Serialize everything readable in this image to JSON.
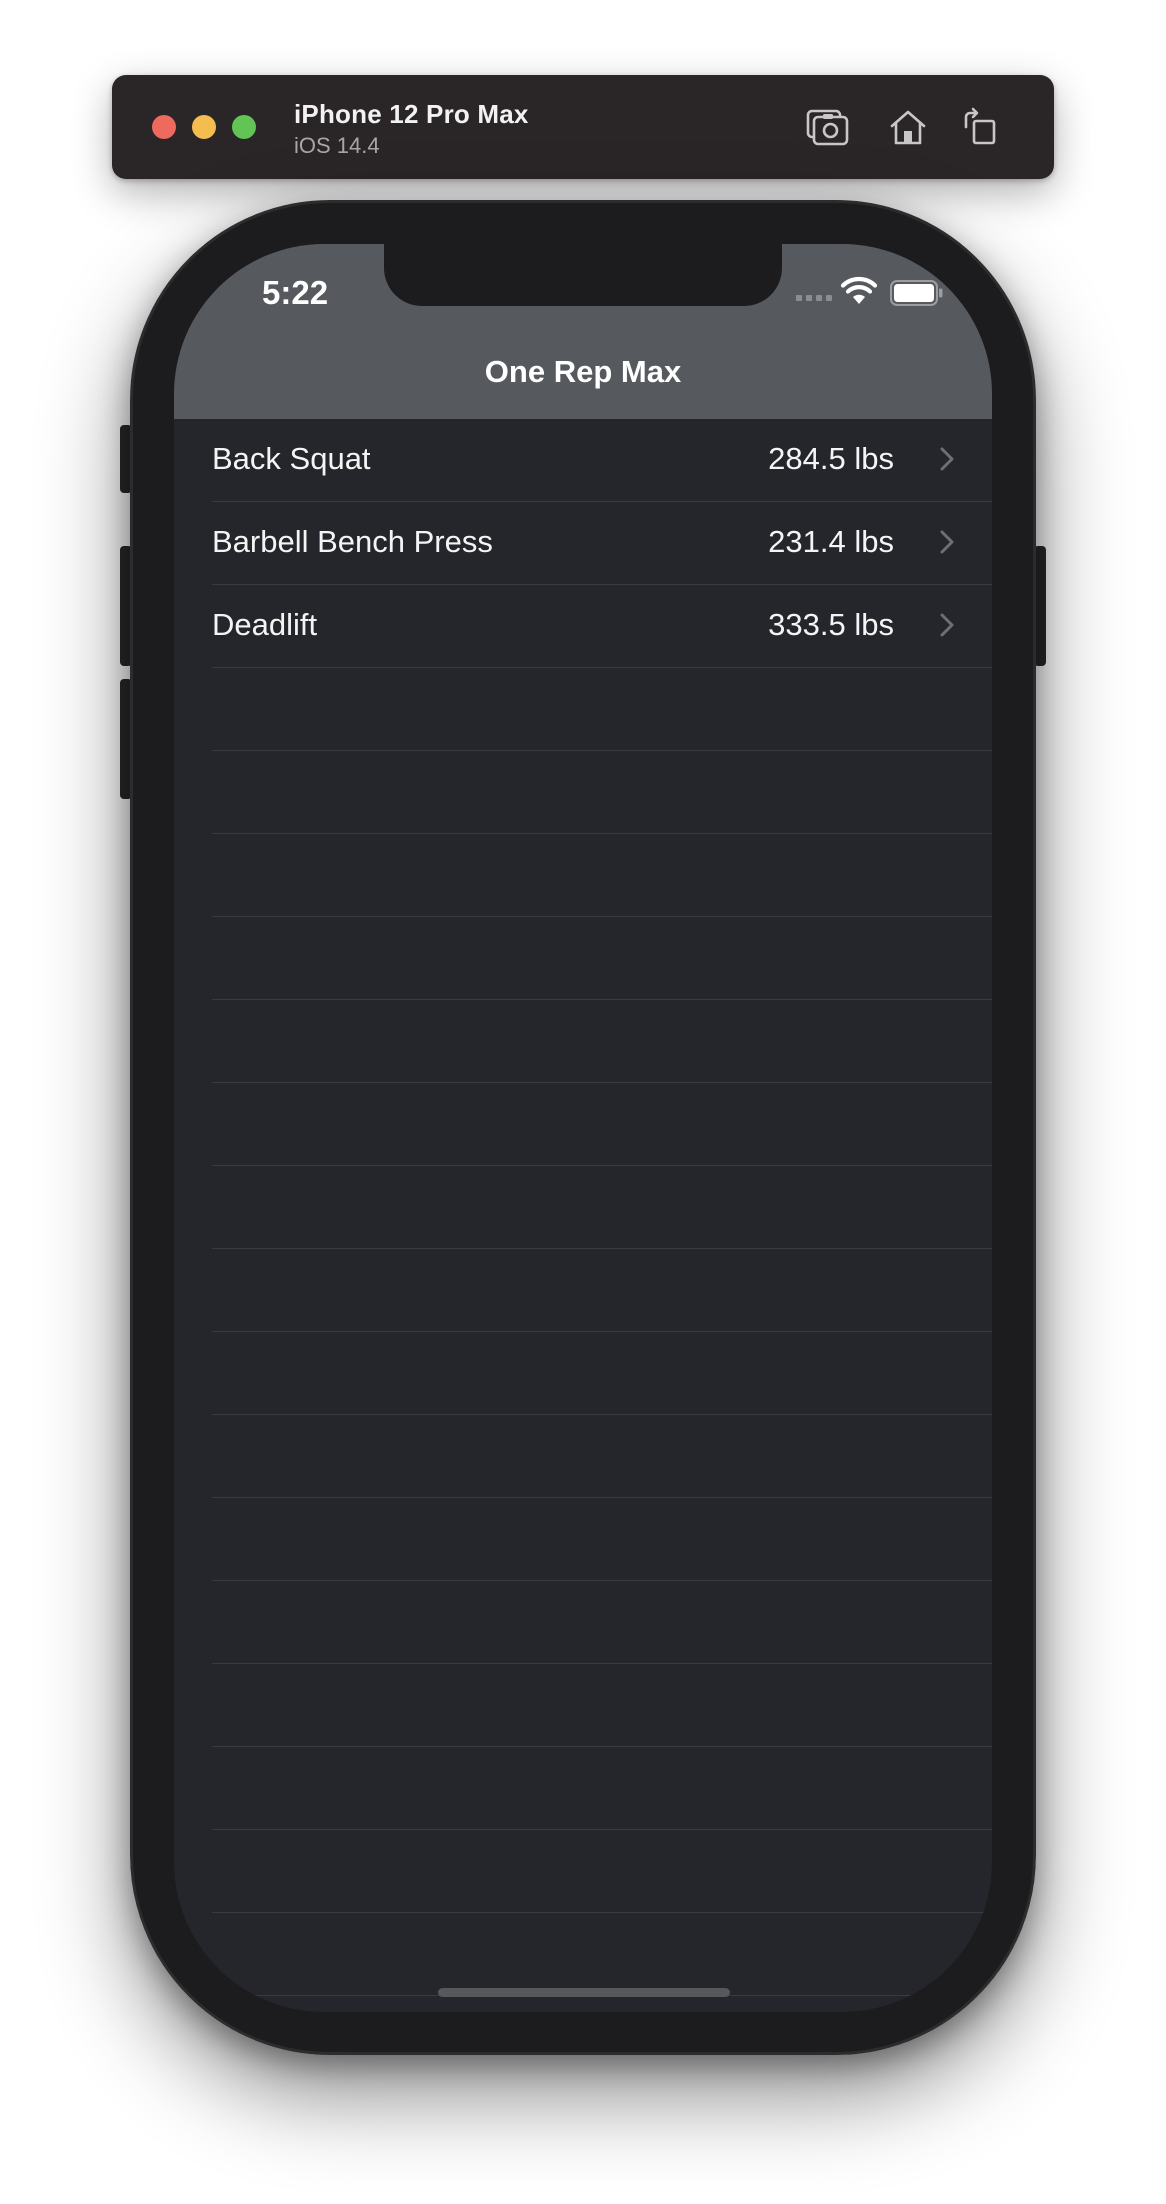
{
  "simulator": {
    "device_name": "iPhone 12 Pro Max",
    "os_version": "iOS 14.4",
    "icons": [
      "screenshot-icon",
      "home-icon",
      "rotate-icon"
    ]
  },
  "status_bar": {
    "time": "5:22",
    "icons": [
      "cellular-signal-icon",
      "wifi-icon",
      "battery-icon"
    ]
  },
  "navigation": {
    "title": "One Rep Max"
  },
  "exercises": [
    {
      "name": "Back Squat",
      "value": "284.5 lbs"
    },
    {
      "name": "Barbell Bench Press",
      "value": "231.4 lbs"
    },
    {
      "name": "Deadlift",
      "value": "333.5 lbs"
    }
  ],
  "colors": {
    "navigation_background": "#56595e",
    "list_background": "#24262b",
    "separator": "#393b40",
    "text": "#f4f4f5"
  }
}
